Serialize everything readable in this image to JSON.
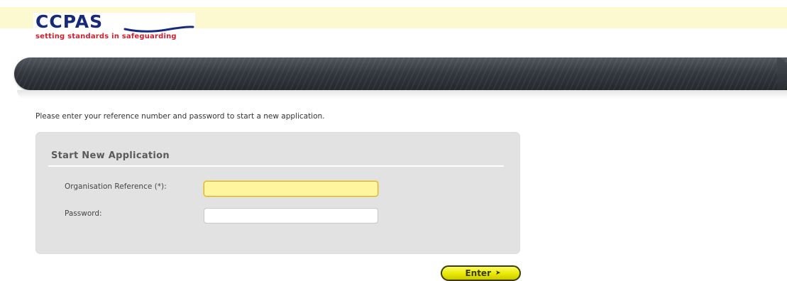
{
  "brand": {
    "name": "CCPAS",
    "tagline": "setting standards in safeguarding",
    "primary_color": "#172a7a",
    "tagline_color": "#d0202e"
  },
  "intro_text": "Please enter your reference number and password to start a new application.",
  "form": {
    "title": "Start New Application",
    "fields": [
      {
        "label": "Organisation Reference (*):",
        "value": "",
        "focused": true
      },
      {
        "label": "Password:",
        "value": "",
        "focused": false
      }
    ],
    "submit_label": "Enter",
    "submit_icon": "arrow-right-icon",
    "focus_color": "#fff59f",
    "button_color": "#e8ea00"
  }
}
